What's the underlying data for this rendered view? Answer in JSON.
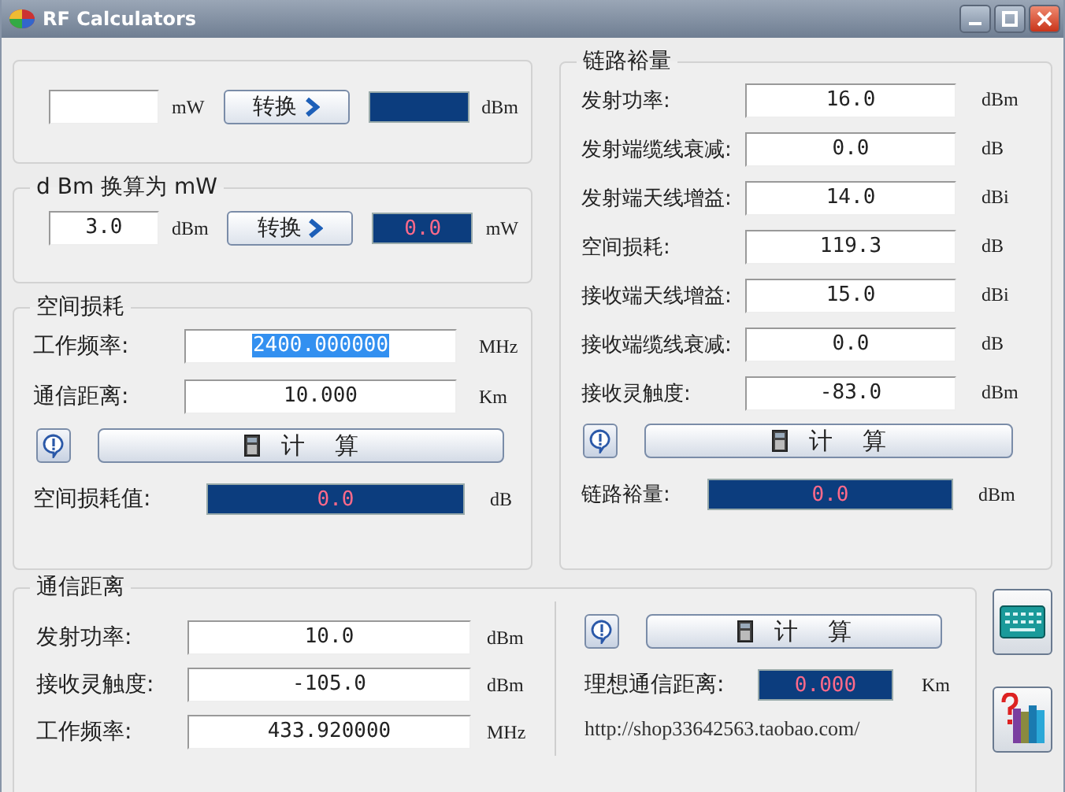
{
  "window": {
    "title": "RF Calculators"
  },
  "mw_to_dbm": {
    "input_unit": "mW",
    "button": "转换",
    "output_unit": "dBm"
  },
  "dbm_to_mw": {
    "title": "d Bm 换算为 mW",
    "input": "3.0",
    "input_unit": "dBm",
    "button": "转换",
    "output": "0.0",
    "output_unit": "mW"
  },
  "path_loss": {
    "title": "空间损耗",
    "fields": [
      {
        "label": "工作频率:",
        "value": "2400.000000",
        "unit": "MHz",
        "highlighted": true
      },
      {
        "label": "通信距离:",
        "value": "10.000",
        "unit": "Km",
        "highlighted": false
      }
    ],
    "button": "计 算",
    "result_label": "空间损耗值:",
    "result": "0.0",
    "result_unit": "dB"
  },
  "link_margin": {
    "title": "链路裕量",
    "fields": [
      {
        "label": "发射功率:",
        "value": "16.0",
        "unit": "dBm"
      },
      {
        "label": "发射端缆线衰减:",
        "value": "0.0",
        "unit": "dB"
      },
      {
        "label": "发射端天线增益:",
        "value": "14.0",
        "unit": "dBi"
      },
      {
        "label": "空间损耗:",
        "value": "119.3",
        "unit": "dB"
      },
      {
        "label": "接收端天线增益:",
        "value": "15.0",
        "unit": "dBi"
      },
      {
        "label": "接收端缆线衰减:",
        "value": "0.0",
        "unit": "dB"
      },
      {
        "label": "接收灵触度:",
        "value": "-83.0",
        "unit": "dBm"
      }
    ],
    "button": "计 算",
    "result_label": "链路裕量:",
    "result": "0.0",
    "result_unit": "dBm"
  },
  "comm_distance": {
    "title": "通信距离",
    "fields": [
      {
        "label": "发射功率:",
        "value": "10.0",
        "unit": "dBm"
      },
      {
        "label": "接收灵触度:",
        "value": "-105.0",
        "unit": "dBm"
      },
      {
        "label": "工作频率:",
        "value": "433.920000",
        "unit": "MHz"
      }
    ],
    "button": "计 算",
    "result_label": "理想通信距离:",
    "result": "0.000",
    "result_unit": "Km",
    "url": "http://shop33642563.taobao.com/"
  }
}
